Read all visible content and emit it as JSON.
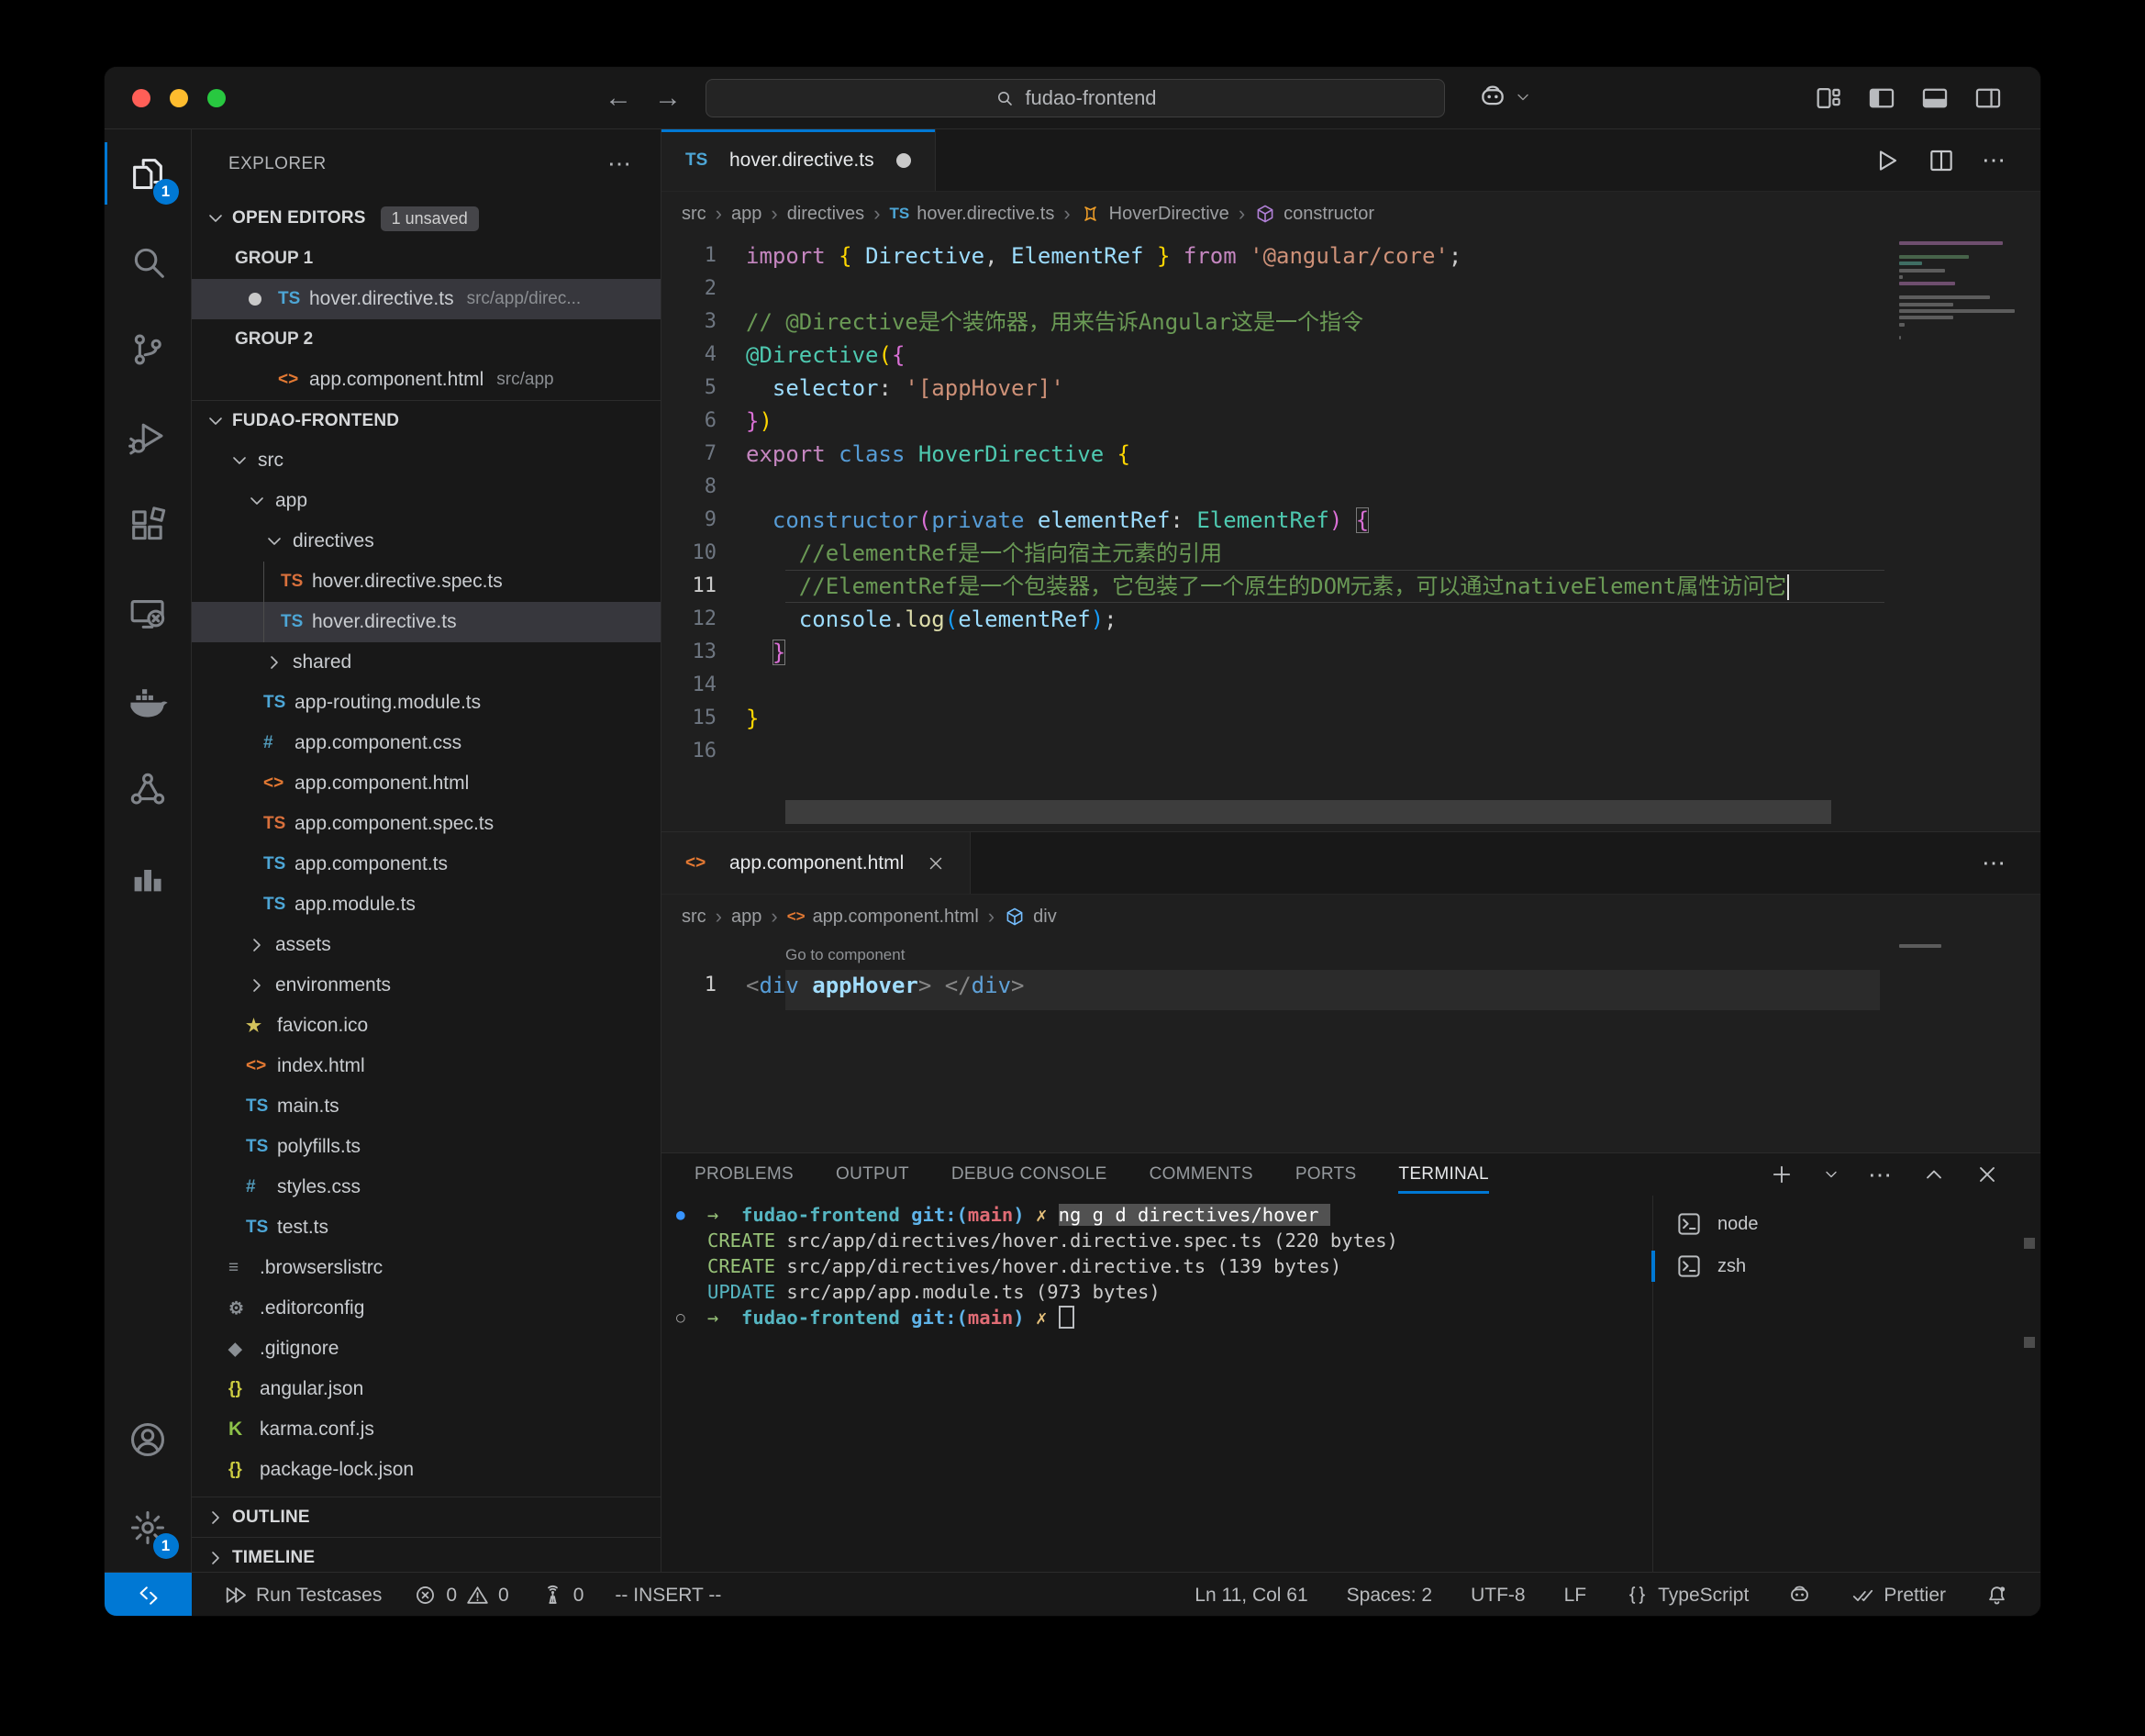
{
  "titlebar": {
    "search_value": "fudao-frontend",
    "nav_back": "←",
    "nav_forward": "→",
    "right_icons": [
      "customize-layout",
      "toggle-primary-sidebar",
      "toggle-panel",
      "toggle-secondary-sidebar"
    ]
  },
  "activity_bar": {
    "top": [
      {
        "name": "explorer",
        "icon": "files",
        "active": true,
        "badge": "1"
      },
      {
        "name": "search",
        "icon": "search"
      },
      {
        "name": "source-control",
        "icon": "source-control"
      },
      {
        "name": "run-debug",
        "icon": "debug"
      },
      {
        "name": "extensions",
        "icon": "extensions"
      },
      {
        "name": "remote-explorer",
        "icon": "remote-monitor"
      },
      {
        "name": "docker",
        "icon": "docker-whale"
      },
      {
        "name": "kubernetes",
        "icon": "network-nodes"
      },
      {
        "name": "metrics",
        "icon": "bar-chart"
      }
    ],
    "bottom": [
      {
        "name": "accounts",
        "icon": "account"
      },
      {
        "name": "settings",
        "icon": "gear",
        "badge": "1"
      }
    ]
  },
  "sidebar": {
    "title": "EXPLORER",
    "open_editors": {
      "label": "OPEN EDITORS",
      "badge": "1 unsaved",
      "groups": [
        {
          "label": "GROUP 1",
          "items": [
            {
              "icon": "ts-blue",
              "label": "hover.directive.ts",
              "desc": "src/app/direc...",
              "modified": true,
              "selected": true
            }
          ]
        },
        {
          "label": "GROUP 2",
          "items": [
            {
              "icon": "html",
              "label": "app.component.html",
              "desc": "src/app",
              "modified": false,
              "selected": false
            }
          ]
        }
      ]
    },
    "project_label": "FUDAO-FRONTEND",
    "tree": [
      {
        "indent": 0,
        "type": "folder",
        "chevron": "down",
        "label": "src"
      },
      {
        "indent": 1,
        "type": "folder",
        "chevron": "down",
        "label": "app"
      },
      {
        "indent": 2,
        "type": "folder",
        "chevron": "down",
        "label": "directives"
      },
      {
        "indent": 3,
        "type": "file",
        "icon": "ts-orange",
        "label": "hover.directive.spec.ts",
        "guide": true
      },
      {
        "indent": 3,
        "type": "file",
        "icon": "ts-blue",
        "label": "hover.directive.ts",
        "selected": true,
        "guide": true
      },
      {
        "indent": 2,
        "type": "folder",
        "chevron": "right",
        "label": "shared"
      },
      {
        "indent": 2,
        "type": "file",
        "icon": "ts-blue",
        "label": "app-routing.module.ts"
      },
      {
        "indent": 2,
        "type": "file",
        "icon": "css",
        "label": "app.component.css"
      },
      {
        "indent": 2,
        "type": "file",
        "icon": "html",
        "label": "app.component.html"
      },
      {
        "indent": 2,
        "type": "file",
        "icon": "ts-orange",
        "label": "app.component.spec.ts"
      },
      {
        "indent": 2,
        "type": "file",
        "icon": "ts-blue",
        "label": "app.component.ts"
      },
      {
        "indent": 2,
        "type": "file",
        "icon": "ts-blue",
        "label": "app.module.ts"
      },
      {
        "indent": 1,
        "type": "folder",
        "chevron": "right",
        "label": "assets"
      },
      {
        "indent": 1,
        "type": "folder",
        "chevron": "right",
        "label": "environments"
      },
      {
        "indent": 1,
        "type": "file",
        "icon": "star",
        "label": "favicon.ico"
      },
      {
        "indent": 1,
        "type": "file",
        "icon": "html",
        "label": "index.html"
      },
      {
        "indent": 1,
        "type": "file",
        "icon": "ts-blue",
        "label": "main.ts"
      },
      {
        "indent": 1,
        "type": "file",
        "icon": "ts-blue",
        "label": "polyfills.ts"
      },
      {
        "indent": 1,
        "type": "file",
        "icon": "css",
        "label": "styles.css"
      },
      {
        "indent": 1,
        "type": "file",
        "icon": "ts-blue",
        "label": "test.ts"
      },
      {
        "indent": 0,
        "type": "file",
        "icon": "list",
        "label": ".browserslistrc"
      },
      {
        "indent": 0,
        "type": "file",
        "icon": "gear-file",
        "label": ".editorconfig"
      },
      {
        "indent": 0,
        "type": "file",
        "icon": "git",
        "label": ".gitignore"
      },
      {
        "indent": 0,
        "type": "file",
        "icon": "json",
        "label": "angular.json"
      },
      {
        "indent": 0,
        "type": "file",
        "icon": "karma",
        "label": "karma.conf.js"
      },
      {
        "indent": 0,
        "type": "file",
        "icon": "json",
        "label": "package-lock.json"
      }
    ],
    "outline_label": "OUTLINE",
    "timeline_label": "TIMELINE"
  },
  "editor1": {
    "tab": {
      "label": "hover.directive.ts",
      "icon": "ts-blue",
      "modified": true
    },
    "breadcrumbs": [
      {
        "label": "src"
      },
      {
        "label": "app"
      },
      {
        "label": "directives"
      },
      {
        "label": "hover.directive.ts",
        "ficon": "ts-blue"
      },
      {
        "label": "HoverDirective",
        "icon": "symbol-class"
      },
      {
        "label": "constructor",
        "icon": "symbol-method"
      }
    ],
    "active_line": 11,
    "lines": [
      {
        "n": 1,
        "segs": [
          {
            "t": "import ",
            "c": "kw"
          },
          {
            "t": "{ ",
            "c": "b1"
          },
          {
            "t": "Directive",
            "c": "var"
          },
          {
            "t": ", ",
            "c": "pl"
          },
          {
            "t": "ElementRef",
            "c": "var"
          },
          {
            "t": " }",
            "c": "b1"
          },
          {
            "t": " from ",
            "c": "kw"
          },
          {
            "t": "'@angular/core'",
            "c": "str"
          },
          {
            "t": ";",
            "c": "pl"
          }
        ]
      },
      {
        "n": 2,
        "segs": []
      },
      {
        "n": 3,
        "segs": [
          {
            "t": "// @Directive是个装饰器，用来告诉Angular这是一个指令",
            "c": "cmt"
          }
        ]
      },
      {
        "n": 4,
        "segs": [
          {
            "t": "@Directive",
            "c": "type"
          },
          {
            "t": "(",
            "c": "b1"
          },
          {
            "t": "{",
            "c": "b2"
          }
        ]
      },
      {
        "n": 5,
        "segs": [
          {
            "t": "  ",
            "c": "pl"
          },
          {
            "t": "selector",
            "c": "var"
          },
          {
            "t": ": ",
            "c": "pl"
          },
          {
            "t": "'[appHover]'",
            "c": "str"
          }
        ]
      },
      {
        "n": 6,
        "segs": [
          {
            "t": "}",
            "c": "b2"
          },
          {
            "t": ")",
            "c": "b1"
          }
        ]
      },
      {
        "n": 7,
        "segs": [
          {
            "t": "export ",
            "c": "kw"
          },
          {
            "t": "class ",
            "c": "kw2"
          },
          {
            "t": "HoverDirective ",
            "c": "type"
          },
          {
            "t": "{",
            "c": "b1"
          }
        ]
      },
      {
        "n": 8,
        "segs": []
      },
      {
        "n": 9,
        "segs": [
          {
            "t": "  ",
            "c": "pl"
          },
          {
            "t": "constructor",
            "c": "kw2"
          },
          {
            "t": "(",
            "c": "b2"
          },
          {
            "t": "private ",
            "c": "kw2"
          },
          {
            "t": "elementRef",
            "c": "var"
          },
          {
            "t": ": ",
            "c": "pl"
          },
          {
            "t": "ElementRef",
            "c": "type"
          },
          {
            "t": ")",
            "c": "b2"
          },
          {
            "t": " ",
            "c": "pl"
          },
          {
            "t": "{",
            "c": "b2",
            "box": true
          }
        ]
      },
      {
        "n": 10,
        "segs": [
          {
            "t": "    ",
            "c": "pl"
          },
          {
            "t": "//elementRef是一个指向宿主元素的引用",
            "c": "cmt"
          }
        ]
      },
      {
        "n": 11,
        "cursor": true,
        "segs": [
          {
            "t": "    ",
            "c": "pl"
          },
          {
            "t": "//ElementRef是一个包装器，它包装了一个原生的DOM元素，可以通过nativeElement属性访问它",
            "c": "cmt"
          }
        ]
      },
      {
        "n": 12,
        "segs": [
          {
            "t": "    ",
            "c": "pl"
          },
          {
            "t": "console",
            "c": "var"
          },
          {
            "t": ".",
            "c": "pl"
          },
          {
            "t": "log",
            "c": "fn"
          },
          {
            "t": "(",
            "c": "b3"
          },
          {
            "t": "elementRef",
            "c": "var"
          },
          {
            "t": ")",
            "c": "b3"
          },
          {
            "t": ";",
            "c": "pl"
          }
        ]
      },
      {
        "n": 13,
        "segs": [
          {
            "t": "  ",
            "c": "pl"
          },
          {
            "t": "}",
            "c": "b2",
            "box": true
          }
        ]
      },
      {
        "n": 14,
        "segs": []
      },
      {
        "n": 15,
        "segs": [
          {
            "t": "}",
            "c": "b1"
          }
        ]
      },
      {
        "n": 16,
        "segs": []
      }
    ]
  },
  "editor2": {
    "tab": {
      "label": "app.component.html",
      "icon": "html",
      "closable": true
    },
    "breadcrumbs": [
      {
        "label": "src"
      },
      {
        "label": "app"
      },
      {
        "label": "app.component.html",
        "ficon": "html"
      },
      {
        "label": "div",
        "icon": "symbol-field"
      }
    ],
    "codelens": "Go to component",
    "active_line": 1,
    "lines": [
      {
        "n": 1,
        "segs": [
          {
            "t": "<",
            "c": "pun"
          },
          {
            "t": "div",
            "c": "kw2"
          },
          {
            "t": " ",
            "c": "pl"
          },
          {
            "t": "appHover",
            "c": "attr"
          },
          {
            "t": ">",
            "c": "pun"
          },
          {
            "t": " ",
            "c": "pl"
          },
          {
            "t": "</",
            "c": "pun"
          },
          {
            "t": "div",
            "c": "kw2"
          },
          {
            "t": ">",
            "c": "pun"
          }
        ]
      }
    ]
  },
  "panel": {
    "tabs": [
      "PROBLEMS",
      "OUTPUT",
      "DEBUG CONSOLE",
      "COMMENTS",
      "PORTS",
      "TERMINAL"
    ],
    "active_tab": "TERMINAL",
    "terminal_lines": [
      {
        "deco": "blue",
        "segs": [
          {
            "t": "→  ",
            "c": "tgreen"
          },
          {
            "t": "fudao-frontend ",
            "c": "tcyan"
          },
          {
            "t": "git:(",
            "c": "tblue"
          },
          {
            "t": "main",
            "c": "tred"
          },
          {
            "t": ") ",
            "c": "tblue"
          },
          {
            "t": "✗ ",
            "c": "tyellow"
          },
          {
            "t": "ng g d directives/hover ",
            "c": "tsel"
          }
        ]
      },
      {
        "deco": null,
        "segs": [
          {
            "t": "CREATE ",
            "c": "tgreen"
          },
          {
            "t": "src/app/directives/hover.directive.spec.ts (220 bytes)",
            "c": "tplain"
          }
        ]
      },
      {
        "deco": null,
        "segs": [
          {
            "t": "CREATE ",
            "c": "tgreen"
          },
          {
            "t": "src/app/directives/hover.directive.ts (139 bytes)",
            "c": "tplain"
          }
        ]
      },
      {
        "deco": null,
        "segs": [
          {
            "t": "UPDATE ",
            "c": "tcyan2"
          },
          {
            "t": "src/app/app.module.ts (973 bytes)",
            "c": "tplain"
          }
        ]
      },
      {
        "deco": "gray",
        "segs": [
          {
            "t": "→  ",
            "c": "tgreen"
          },
          {
            "t": "fudao-frontend ",
            "c": "tcyan"
          },
          {
            "t": "git:(",
            "c": "tblue"
          },
          {
            "t": "main",
            "c": "tred"
          },
          {
            "t": ") ",
            "c": "tblue"
          },
          {
            "t": "✗ ",
            "c": "tyellow"
          },
          {
            "cursor": true
          }
        ]
      }
    ],
    "terminal_list": [
      {
        "icon": "terminal-box",
        "label": "node",
        "active": false
      },
      {
        "icon": "terminal-box",
        "label": "zsh",
        "active": true
      }
    ]
  },
  "status_bar": {
    "left": [
      {
        "name": "run-testcases",
        "parts": [
          {
            "icon": "run-all"
          },
          {
            "t": "Run Testcases"
          }
        ]
      },
      {
        "name": "problems",
        "parts": [
          {
            "icon": "circle-x"
          },
          {
            "t": "0"
          },
          {
            "icon": "warning"
          },
          {
            "t": "0"
          }
        ]
      },
      {
        "name": "ports-forwarded",
        "parts": [
          {
            "icon": "radio-tower"
          },
          {
            "t": "0"
          }
        ]
      },
      {
        "name": "vim-mode",
        "parts": [
          {
            "t": "-- INSERT --"
          }
        ]
      }
    ],
    "right": [
      {
        "name": "cursor-position",
        "parts": [
          {
            "t": "Ln 11, Col 61"
          }
        ]
      },
      {
        "name": "indentation",
        "parts": [
          {
            "t": "Spaces: 2"
          }
        ]
      },
      {
        "name": "encoding",
        "parts": [
          {
            "t": "UTF-8"
          }
        ]
      },
      {
        "name": "eol",
        "parts": [
          {
            "t": "LF"
          }
        ]
      },
      {
        "name": "language-mode",
        "parts": [
          {
            "icon": "braces"
          },
          {
            "t": "TypeScript"
          }
        ]
      },
      {
        "name": "copilot-status",
        "parts": [
          {
            "icon": "copilot"
          }
        ]
      },
      {
        "name": "formatter",
        "parts": [
          {
            "icon": "double-check"
          },
          {
            "t": "Prettier"
          }
        ]
      },
      {
        "name": "notifications",
        "parts": [
          {
            "icon": "bell-dot"
          }
        ]
      }
    ]
  }
}
